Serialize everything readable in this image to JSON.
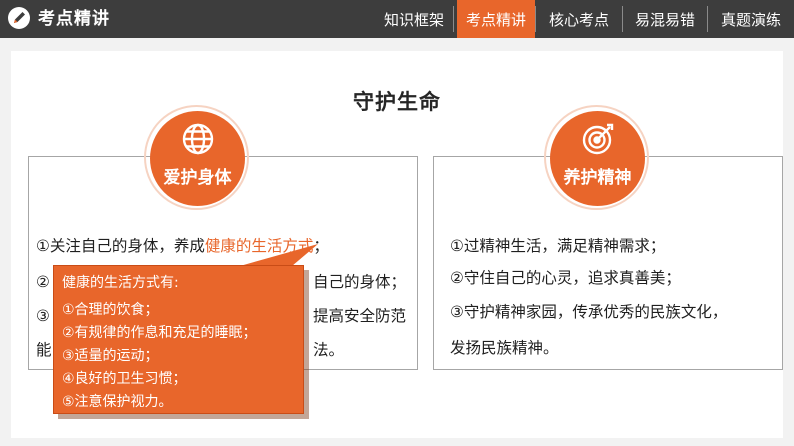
{
  "header": {
    "title": "考点精讲",
    "tabs": [
      {
        "label": "知识框架",
        "active": false
      },
      {
        "label": "考点精讲",
        "active": true
      },
      {
        "label": "核心考点",
        "active": false
      },
      {
        "label": "易混易错",
        "active": false
      },
      {
        "label": "真题演练",
        "active": false
      }
    ]
  },
  "main": {
    "heading": "守护生命",
    "left_card": {
      "badge": "爱护身体",
      "icon": "globe-icon",
      "line1_prefix": "①关注自己的身体，养成",
      "line1_highlight": "健康的生活方式",
      "line1_suffix": "；",
      "line2_start": "②",
      "line2_end": "自己的身体；",
      "line3_start": "③",
      "line3_end": "提高安全防范",
      "line4_start": "能",
      "line4_end": "法。"
    },
    "right_card": {
      "badge": "养护精神",
      "icon": "target-icon",
      "lines": [
        "①过精神生活，满足精神需求；",
        "②守住自己的心灵，追求真善美；",
        "③守护精神家园，传承优秀的民族文化，",
        "发扬民族精神。"
      ]
    },
    "popup": {
      "title": "健康的生活方式有:",
      "items": [
        "①合理的饮食；",
        "②有规律的作息和充足的睡眠；",
        "③适量的运动；",
        "④良好的卫生习惯；",
        "⑤注意保护视力。"
      ]
    }
  },
  "colors": {
    "accent": "#e8662b",
    "topbar": "#3d3d3d",
    "background": "#f2f2f2"
  }
}
